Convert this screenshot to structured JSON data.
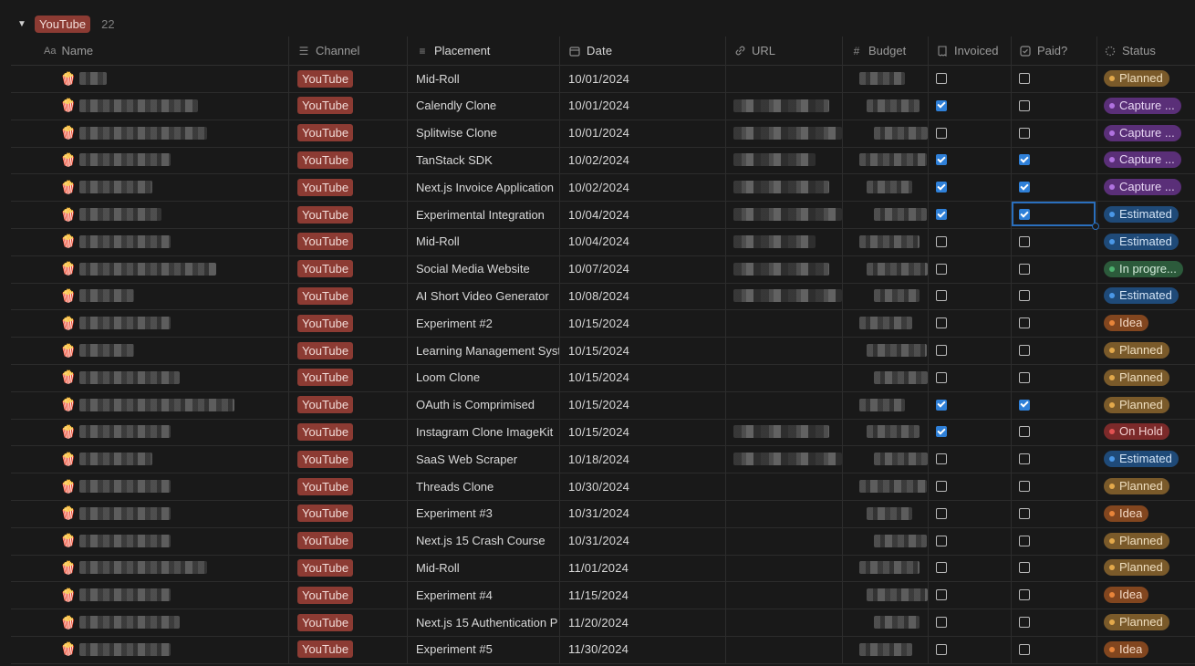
{
  "group": {
    "toggle_icon": "triangle-down-icon",
    "tag": "YouTube",
    "count": "22"
  },
  "columns": [
    {
      "key": "name",
      "label": "Name",
      "icon": "Aa"
    },
    {
      "key": "channel",
      "label": "Channel",
      "icon": "list-icon"
    },
    {
      "key": "placement",
      "label": "Placement",
      "icon": "text-lines-icon"
    },
    {
      "key": "date",
      "label": "Date",
      "icon": "calendar-icon"
    },
    {
      "key": "url",
      "label": "URL",
      "icon": "link-icon"
    },
    {
      "key": "budget",
      "label": "Budget",
      "icon": "hash-icon"
    },
    {
      "key": "invoiced",
      "label": "Invoiced",
      "icon": "receipt-icon"
    },
    {
      "key": "paid",
      "label": "Paid?",
      "icon": "checkbox-icon"
    },
    {
      "key": "status",
      "label": "Status",
      "icon": "status-spinner-icon"
    }
  ],
  "status_colors": {
    "Planned": "#e3a94b",
    "Capture": "#b072e0",
    "Estimated": "#4a97e6",
    "In progress": "#4cb06e",
    "Idea": "#e8843a",
    "On Hold": "#e25252"
  },
  "rows": [
    {
      "emoji": "🍿",
      "channel": "YouTube",
      "placement": "Mid-Roll",
      "date": "10/01/2024",
      "invoiced": false,
      "paid": false,
      "status": "Planned",
      "status_class": "s-planned"
    },
    {
      "emoji": "🍿",
      "channel": "YouTube",
      "placement": "Calendly Clone",
      "date": "10/01/2024",
      "invoiced": true,
      "paid": false,
      "status": "Capture ...",
      "status_class": "s-capture"
    },
    {
      "emoji": "🍿",
      "channel": "YouTube",
      "placement": "Splitwise Clone",
      "date": "10/01/2024",
      "invoiced": false,
      "paid": false,
      "status": "Capture ...",
      "status_class": "s-capture"
    },
    {
      "emoji": "🍿",
      "channel": "YouTube",
      "placement": "TanStack SDK",
      "date": "10/02/2024",
      "invoiced": true,
      "paid": true,
      "status": "Capture ...",
      "status_class": "s-capture"
    },
    {
      "emoji": "🍿",
      "channel": "YouTube",
      "placement": "Next.js Invoice Application",
      "date": "10/02/2024",
      "invoiced": true,
      "paid": true,
      "status": "Capture ...",
      "status_class": "s-capture"
    },
    {
      "emoji": "🍿",
      "channel": "YouTube",
      "placement": "Experimental Integration",
      "date": "10/04/2024",
      "invoiced": true,
      "paid": true,
      "status": "Estimated",
      "status_class": "s-estimated"
    },
    {
      "emoji": "🍿",
      "channel": "YouTube",
      "placement": "Mid-Roll",
      "date": "10/04/2024",
      "invoiced": false,
      "paid": false,
      "status": "Estimated",
      "status_class": "s-estimated"
    },
    {
      "emoji": "🍿",
      "channel": "YouTube",
      "placement": "Social Media Website",
      "date": "10/07/2024",
      "invoiced": false,
      "paid": false,
      "status": "In progre...",
      "status_class": "s-progress"
    },
    {
      "emoji": "🍿",
      "channel": "YouTube",
      "placement": "AI Short Video Generator",
      "date": "10/08/2024",
      "invoiced": false,
      "paid": false,
      "status": "Estimated",
      "status_class": "s-estimated"
    },
    {
      "emoji": "🍿",
      "channel": "YouTube",
      "placement": "Experiment #2",
      "date": "10/15/2024",
      "invoiced": false,
      "paid": false,
      "status": "Idea",
      "status_class": "s-idea"
    },
    {
      "emoji": "🍿",
      "channel": "YouTube",
      "placement": "Learning Management Syst",
      "date": "10/15/2024",
      "invoiced": false,
      "paid": false,
      "status": "Planned",
      "status_class": "s-planned"
    },
    {
      "emoji": "🍿",
      "channel": "YouTube",
      "placement": "Loom Clone",
      "date": "10/15/2024",
      "invoiced": false,
      "paid": false,
      "status": "Planned",
      "status_class": "s-planned"
    },
    {
      "emoji": "🍿",
      "channel": "YouTube",
      "placement": "OAuth is Comprimised",
      "date": "10/15/2024",
      "invoiced": true,
      "paid": true,
      "status": "Planned",
      "status_class": "s-planned"
    },
    {
      "emoji": "🍿",
      "channel": "YouTube",
      "placement": "Instagram Clone ImageKit",
      "date": "10/15/2024",
      "invoiced": true,
      "paid": false,
      "status": "On Hold",
      "status_class": "s-hold"
    },
    {
      "emoji": "🍿",
      "channel": "YouTube",
      "placement": "SaaS Web Scraper",
      "date": "10/18/2024",
      "invoiced": false,
      "paid": false,
      "status": "Estimated",
      "status_class": "s-estimated"
    },
    {
      "emoji": "🍿",
      "channel": "YouTube",
      "placement": "Threads Clone",
      "date": "10/30/2024",
      "invoiced": false,
      "paid": false,
      "status": "Planned",
      "status_class": "s-planned"
    },
    {
      "emoji": "🍿",
      "channel": "YouTube",
      "placement": "Experiment #3",
      "date": "10/31/2024",
      "invoiced": false,
      "paid": false,
      "status": "Idea",
      "status_class": "s-idea"
    },
    {
      "emoji": "🍿",
      "channel": "YouTube",
      "placement": "Next.js 15 Crash Course",
      "date": "10/31/2024",
      "invoiced": false,
      "paid": false,
      "status": "Planned",
      "status_class": "s-planned"
    },
    {
      "emoji": "🍿",
      "channel": "YouTube",
      "placement": "Mid-Roll",
      "date": "11/01/2024",
      "invoiced": false,
      "paid": false,
      "status": "Planned",
      "status_class": "s-planned"
    },
    {
      "emoji": "🍿",
      "channel": "YouTube",
      "placement": "Experiment #4",
      "date": "11/15/2024",
      "invoiced": false,
      "paid": false,
      "status": "Idea",
      "status_class": "s-idea"
    },
    {
      "emoji": "🍿",
      "channel": "YouTube",
      "placement": "Next.js 15 Authentication P",
      "date": "11/20/2024",
      "invoiced": false,
      "paid": false,
      "status": "Planned",
      "status_class": "s-planned"
    },
    {
      "emoji": "🍿",
      "channel": "YouTube",
      "placement": "Experiment #5",
      "date": "11/30/2024",
      "invoiced": false,
      "paid": false,
      "status": "Idea",
      "status_class": "s-idea"
    }
  ]
}
